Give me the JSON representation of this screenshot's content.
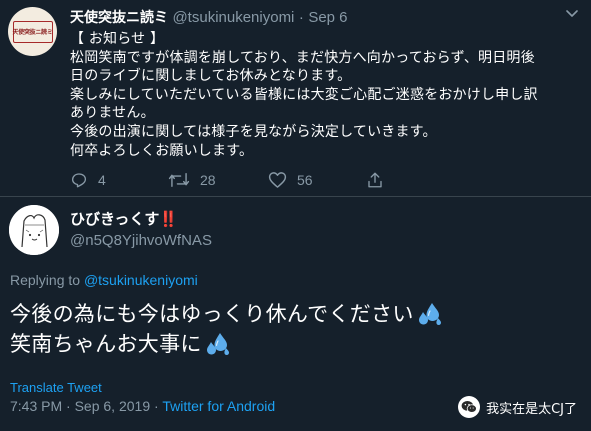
{
  "tweet": {
    "name": "天使突抜ニ読ミ",
    "handle": "@tsukinukeniyomi",
    "separator": "·",
    "date": "Sep 6",
    "avatar_text": "天使突抜ニ読ミ",
    "lines": [
      "【 お知らせ 】",
      "松岡笑南ですが体調を崩しており、まだ快方へ向かっておらず、明日明後",
      "日のライブに関しましてお休みとなります。",
      "楽しみにしていただいている皆様には大変ご心配ご迷惑をおかけし申し訳",
      "ありません。",
      "今後の出演に関しては様子を見ながら決定していきます。",
      "何卒よろしくお願いします。"
    ],
    "actions": {
      "reply_count": "4",
      "retweet_count": "28",
      "like_count": "56"
    }
  },
  "reply": {
    "name": "ひびきっくす",
    "name_emoji": "‼️",
    "handle": "@n5Q8YjihvoWfNAS",
    "replying_prefix": "Replying to",
    "replying_to": "@tsukinukeniyomi",
    "lines": [
      "今後の為にも今はゆっくり休んでください",
      "笑南ちゃんお大事に"
    ],
    "translate_label": "Translate Tweet",
    "time": "7:43 PM",
    "separator": "·",
    "date": "Sep 6, 2019",
    "client": "Twitter for Android"
  },
  "watermark": {
    "text": "我实在是太CJ了"
  },
  "colors": {
    "background": "#15202b",
    "secondary_text": "#8899a6",
    "link": "#1da1f2",
    "divider": "#38444d",
    "emoji_red": "#e0245e",
    "drop_blue": "#5dadec"
  }
}
